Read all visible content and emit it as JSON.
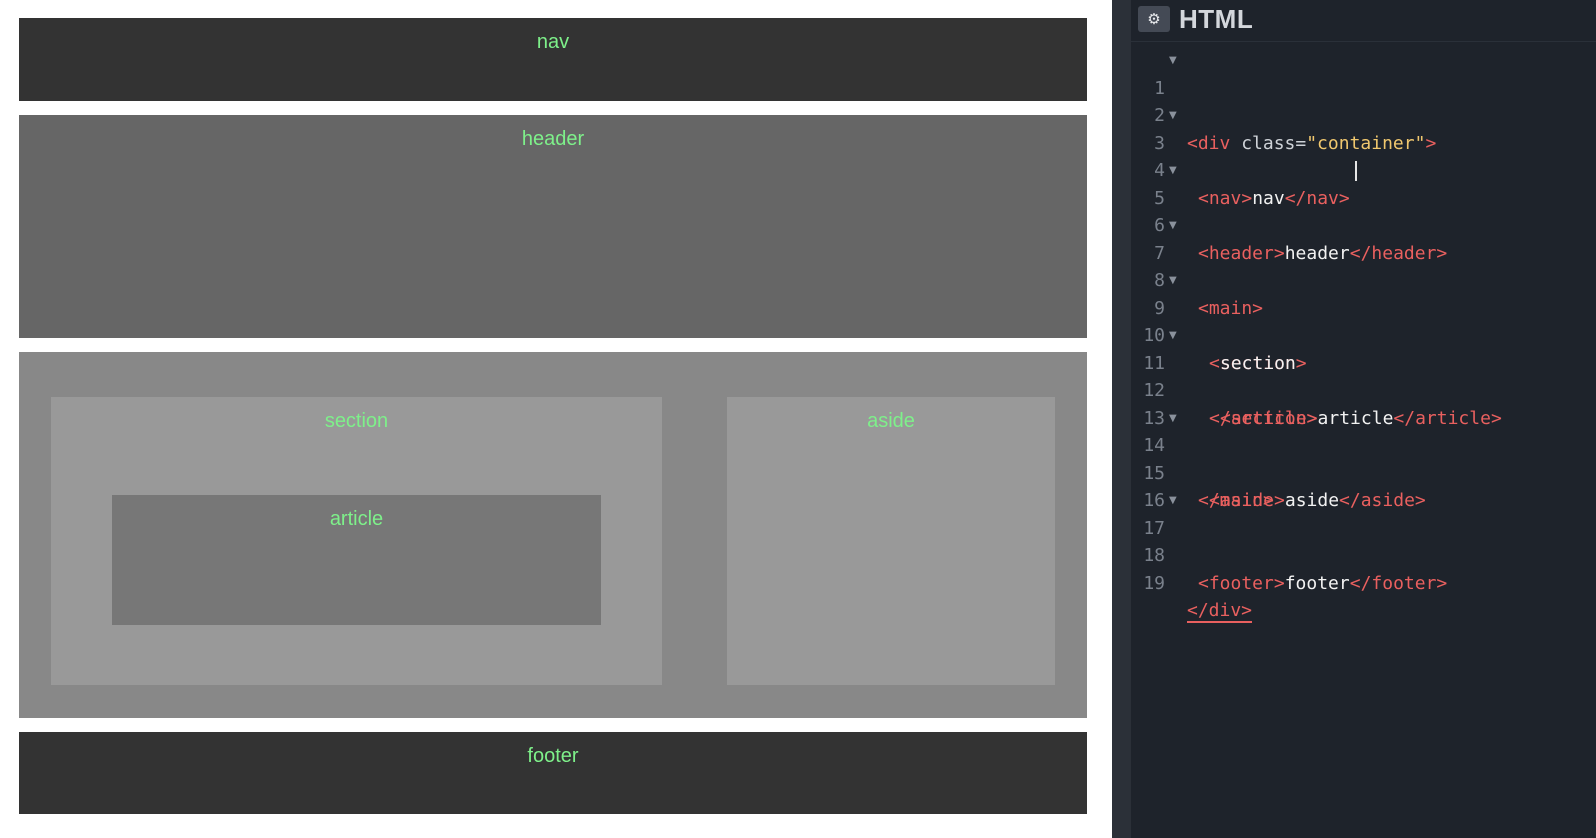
{
  "preview": {
    "nav": "nav",
    "header": "header",
    "section": "section",
    "article": "article",
    "aside": "aside",
    "footer": "footer"
  },
  "editor": {
    "title": "HTML",
    "settings_icon": "gear-icon",
    "line_numbers": [
      "1",
      "2",
      "3",
      "4",
      "5",
      "6",
      "7",
      "8",
      "9",
      "10",
      "11",
      "12",
      "13",
      "14",
      "15",
      "16",
      "17",
      "18",
      "19"
    ],
    "code": {
      "l1_open": "<div ",
      "l1_attr": "class=",
      "l1_str": "\"container\"",
      "l1_close": ">",
      "l3_open": "<nav>",
      "l3_text": "nav",
      "l3_close": "</nav>",
      "l5_open": "<header>",
      "l5_text": "header",
      "l5_close": "</header>",
      "l7": "<main>",
      "l9": "<section>",
      "l10": "section",
      "l11_open": "<article>",
      "l11_text": "article",
      "l11_close": "</article>",
      "l12": "</section>",
      "l14_open": "<aside>",
      "l14_text": "aside",
      "l14_close": "</aside>",
      "l15": "</main>",
      "l17_open": "<footer>",
      "l17_text": "footer",
      "l17_close": "</footer>",
      "l19": "</div>"
    }
  },
  "colors": {
    "label_green": "#7ef08a",
    "tag_red": "#e9605f",
    "string_yellow": "#f0c76e",
    "editor_bg": "#1e232b"
  }
}
